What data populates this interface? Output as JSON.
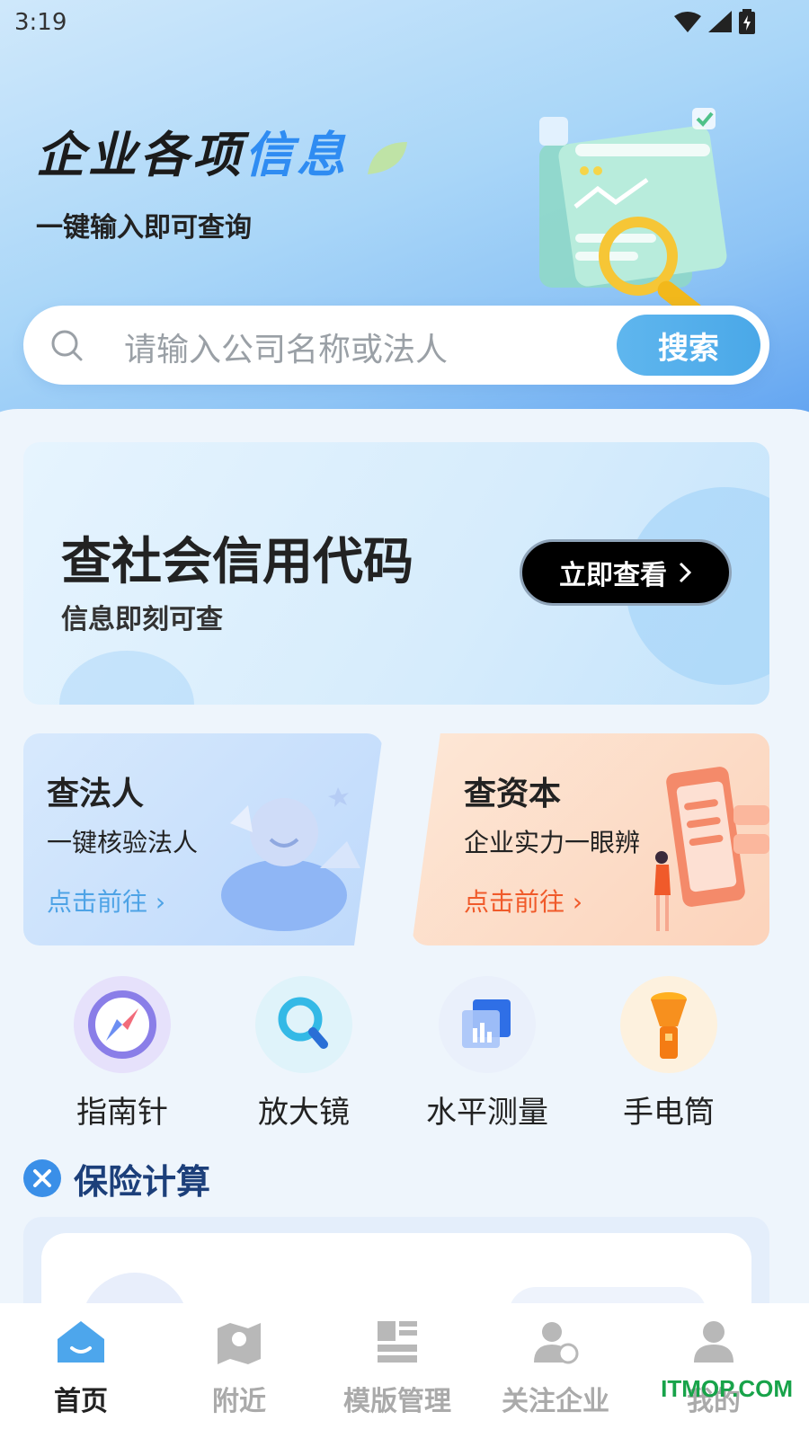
{
  "status_bar": {
    "time": "3:19"
  },
  "hero": {
    "title_dark": "企业各项",
    "title_blue": "信息",
    "subtitle": "一键输入即可查询"
  },
  "search": {
    "placeholder": "请输入公司名称或法人",
    "button_label": "搜索"
  },
  "credit_banner": {
    "title": "查社会信用代码",
    "subtitle": "信息即刻可查",
    "button_label": "立即查看"
  },
  "cards": [
    {
      "title": "查法人",
      "subtitle": "一键核验法人",
      "link": "点击前往"
    },
    {
      "title": "查资本",
      "subtitle": "企业实力一眼辨",
      "link": "点击前往"
    }
  ],
  "tools": [
    {
      "label": "指南针",
      "icon": "compass-icon"
    },
    {
      "label": "放大镜",
      "icon": "magnifier-icon"
    },
    {
      "label": "水平测量",
      "icon": "level-chart-icon"
    },
    {
      "label": "手电筒",
      "icon": "flashlight-icon"
    }
  ],
  "section": {
    "title": "保险计算"
  },
  "tab_bar": {
    "items": [
      {
        "label": "首页",
        "icon": "home-icon",
        "active": true
      },
      {
        "label": "附近",
        "icon": "map-icon",
        "active": false
      },
      {
        "label": "模版管理",
        "icon": "template-icon",
        "active": false
      },
      {
        "label": "关注企业",
        "icon": "follow-icon",
        "active": false
      },
      {
        "label": "我的",
        "icon": "user-icon",
        "active": false
      }
    ]
  },
  "watermark": "ITMOP.COM",
  "colors": {
    "accent_blue": "#2f8cf2",
    "search_button": "#4aa8e8",
    "capital_link": "#f05a2a",
    "legal_link": "#4ea3e6",
    "section_title": "#1c3f7a"
  }
}
